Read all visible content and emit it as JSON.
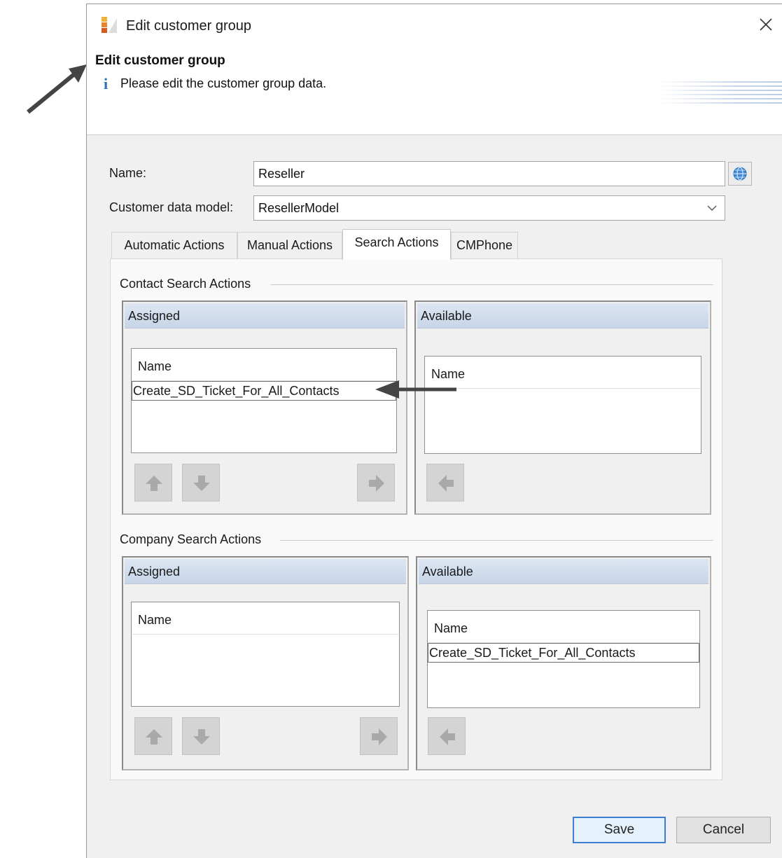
{
  "window": {
    "title": "Edit customer group",
    "close_label": "×"
  },
  "header": {
    "title": "Edit customer group",
    "info_icon": "i",
    "message": "Please edit the customer group data."
  },
  "form": {
    "name_label": "Name:",
    "name_value": "Reseller",
    "model_label": "Customer data model:",
    "model_value": "ResellerModel"
  },
  "tabs": [
    {
      "label": "Automatic Actions",
      "active": false
    },
    {
      "label": "Manual Actions",
      "active": false
    },
    {
      "label": "Search Actions",
      "active": true
    },
    {
      "label": "CMPhone",
      "active": false
    }
  ],
  "contact": {
    "group_title": "Contact Search Actions",
    "assigned": {
      "header": "Assigned",
      "column": "Name",
      "rows": [
        "Create_SD_Ticket_For_All_Contacts"
      ]
    },
    "available": {
      "header": "Available",
      "column": "Name",
      "rows": []
    }
  },
  "company": {
    "group_title": "Company Search Actions",
    "assigned": {
      "header": "Assigned",
      "column": "Name",
      "rows": []
    },
    "available": {
      "header": "Available",
      "column": "Name",
      "rows": [
        "Create_SD_Ticket_For_All_Contacts"
      ]
    }
  },
  "buttons": {
    "save": "Save",
    "cancel": "Cancel"
  },
  "icons": {
    "app": "app-icon",
    "close": "close-icon",
    "info": "info-icon",
    "globe": "globe-icon",
    "combo": "chevron-down-icon",
    "up": "arrow-up-icon",
    "down": "arrow-down-icon",
    "right": "arrow-right-icon",
    "left": "arrow-left-icon"
  },
  "colors": {
    "accent": "#3c7fd1",
    "pane_header": "#c7d5e8",
    "info": "#2b6fb5"
  }
}
